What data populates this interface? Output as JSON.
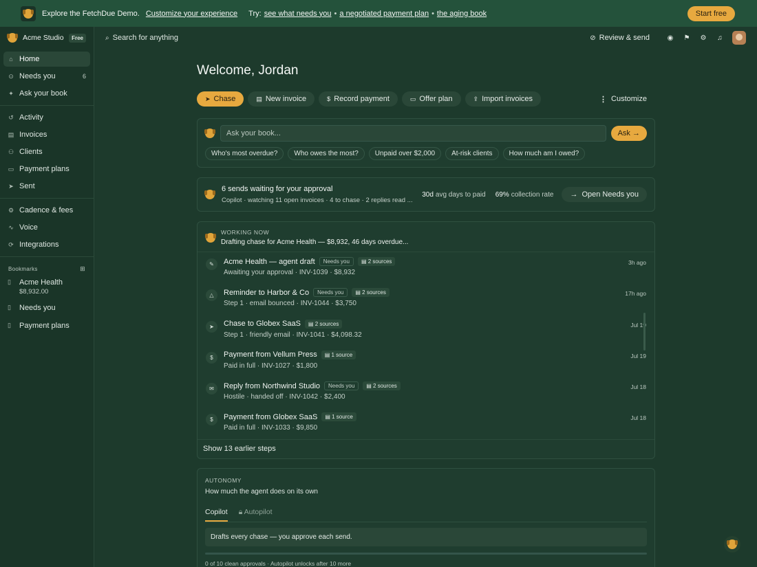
{
  "banner": {
    "title": "Explore the FetchDue Demo.",
    "customize_link": "Customize your experience",
    "try_label": "Try:",
    "try_links": [
      "see what needs you",
      "a negotiated payment plan",
      "the aging book"
    ],
    "start_label": "Start free"
  },
  "workspace": {
    "name": "Acme Studio",
    "plan": "Free"
  },
  "sidebar": {
    "group1": [
      {
        "label": "Home",
        "icon": "home-icon"
      },
      {
        "label": "Needs you",
        "icon": "check-circle-icon",
        "count": "6"
      },
      {
        "label": "Ask your book",
        "icon": "sparkle-icon"
      }
    ],
    "group2": [
      {
        "label": "Activity",
        "icon": "history-icon"
      },
      {
        "label": "Invoices",
        "icon": "document-icon"
      },
      {
        "label": "Clients",
        "icon": "people-icon"
      },
      {
        "label": "Payment plans",
        "icon": "card-icon"
      },
      {
        "label": "Sent",
        "icon": "send-icon"
      }
    ],
    "group3": [
      {
        "label": "Cadence & fees",
        "icon": "sliders-icon"
      },
      {
        "label": "Voice",
        "icon": "voice-icon"
      },
      {
        "label": "Integrations",
        "icon": "sync-icon"
      }
    ],
    "bookmarks_label": "Bookmarks",
    "bookmarks": [
      {
        "label": "Acme Health",
        "sub": "$8,932.00"
      },
      {
        "label": "Needs you"
      },
      {
        "label": "Payment plans"
      }
    ]
  },
  "topbar": {
    "search": "Search for anything",
    "review": "Review & send"
  },
  "main": {
    "welcome": "Welcome, Jordan",
    "actions": [
      "Chase",
      "New invoice",
      "Record payment",
      "Offer plan",
      "Import invoices"
    ],
    "customize": "Customize"
  },
  "ask": {
    "placeholder": "Ask your book...",
    "button": "Ask →",
    "chips": [
      "Who's most overdue?",
      "Who owes the most?",
      "Unpaid over $2,000",
      "At-risk clients",
      "How much am I owed?"
    ]
  },
  "approval": {
    "title": "6 sends waiting for your approval",
    "sub": "Copilot · watching 11 open invoices · 4 to chase · 2 replies read ...",
    "stat1_value": "30d",
    "stat1_label": "avg days to paid",
    "stat2_value": "69%",
    "stat2_label": "collection rate",
    "open_label": "Open Needs you"
  },
  "working": {
    "label": "WORKING NOW",
    "title": "Drafting chase for Acme Health — $8,932, 46 days overdue...",
    "items": [
      {
        "title": "Acme Health — agent draft",
        "tag": "Needs you",
        "sources": "2 sources",
        "sub": "Awaiting your approval · INV-1039 · $8,932",
        "time": "3h ago",
        "icon": "edit-icon",
        "glyph": "✎"
      },
      {
        "title": "Reminder to Harbor & Co",
        "tag": "Needs you",
        "sources": "2 sources",
        "sub": "Step 1 · email bounced · INV-1044 · $3,750",
        "time": "17h ago",
        "icon": "warning-icon",
        "glyph": "△"
      },
      {
        "title": "Chase to Globex SaaS",
        "tag": "",
        "sources": "2 sources",
        "sub": "Step 1 · friendly email · INV-1041 · $4,098.32",
        "time": "Jul 19",
        "icon": "send-icon",
        "glyph": "➤"
      },
      {
        "title": "Payment from Vellum Press",
        "tag": "",
        "sources": "1 source",
        "sub": "Paid in full · INV-1027 · $1,800",
        "time": "Jul 19",
        "icon": "dollar-icon",
        "glyph": "$"
      },
      {
        "title": "Reply from Northwind Studio",
        "tag": "Needs you",
        "sources": "2 sources",
        "sub": "Hostile · handed off · INV-1042 · $2,400",
        "time": "Jul 18",
        "icon": "mail-icon",
        "glyph": "✉"
      },
      {
        "title": "Payment from Globex SaaS",
        "tag": "",
        "sources": "1 source",
        "sub": "Paid in full · INV-1033 · $9,850",
        "time": "Jul 18",
        "icon": "dollar-icon",
        "glyph": "$"
      }
    ],
    "show_earlier": "Show 13 earlier steps"
  },
  "autonomy": {
    "label": "AUTONOMY",
    "title": "How much the agent does on its own",
    "tabs": [
      "Copilot",
      "Autopilot"
    ],
    "mode_text": "Drafts every chase — you approve each send.",
    "progress": 0,
    "footer": "0 of 10 clean approvals · Autopilot unlocks after 10 more"
  },
  "colors": {
    "accent": "#e7a93f",
    "bg": "#1d3a2c",
    "sidebar": "#1a3528"
  }
}
